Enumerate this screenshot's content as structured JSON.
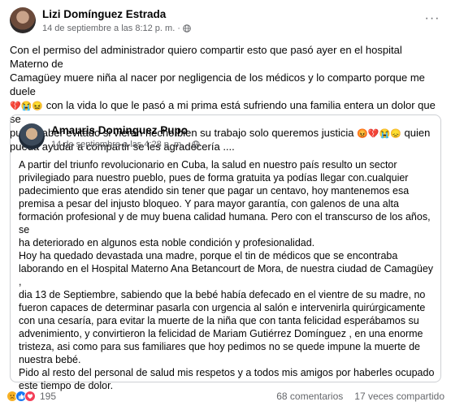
{
  "post": {
    "author": "Lizi Domínguez Estrada",
    "timestamp": "14 de septiembre a las 8:12 p. m.",
    "visibility_separator": "·",
    "more_label": "···",
    "text_line1": "Con el permiso del administrador quiero compartir esto que pasó ayer en el hospital Materno de",
    "text_line2": "Camagüey muere niña al nacer por negligencia de los médicos y lo comparto porque me duele",
    "text_line3_emoji": "💔😭😖",
    "text_line3": " con la vida lo que le pasó a mi prima está sufriendo una familia entera un dolor que se",
    "text_line4": "pudo haber evitado si vieran hecho bien su trabajo solo queremos justicia ",
    "text_line4_emoji": "😡💔😭😞",
    "text_line4_end": " quien",
    "text_line5": "pueda ayudar a compartir se les agradecería ...."
  },
  "shared": {
    "author": "Amauris Dominguez Pupo",
    "timestamp": "14 de septiembre a las 4:28 p. m.",
    "visibility_separator": "·",
    "lines": [
      "A partir del triunfo revolucionario en Cuba, la salud en nuestro país resulto un sector",
      "privilegiado para nuestro pueblo, pues de forma gratuita ya podías llegar con.cualquier",
      "padecimiento que eras atendido sin tener que pagar un centavo, hoy mantenemos esa",
      "premisa a pesar del injusto bloqueo. Y para mayor garantía, con galenos de una alta",
      "formación profesional y de muy buena calidad humana. Pero con el transcurso de los años, se",
      "ha deteriorado en algunos esta noble condición y profesionalidad.",
      "Hoy ha quedado devastada una madre, porque el tin de médicos que se encontraba",
      "laborando en el Hospital Materno Ana Betancourt de Mora, de nuestra ciudad de Camagüey ,",
      "dia 13 de Septiembre, sabiendo que la bebé había defecado en el vientre de su madre, no",
      "fueron capaces de determinar pasarla con urgencia al salón e  intervenirla quirúrgicamente",
      "con una cesaría, para evitar la muerte de la niña que con tanta felicidad esperábamos su",
      "advenimiento, y convirtieron la felicidad de Mariam Gutiérrez Domínguez , en una enorme",
      "tristeza, asi como para sus familiares que hoy pedimos no se quede impune la muerte de",
      "nuestra bebé.",
      "Pido al resto del personal de salud mis respetos y a todos mis amigos por haberles ocupado",
      "este tiempo de dolor."
    ]
  },
  "footer": {
    "reaction_icons": [
      "sad",
      "like",
      "love"
    ],
    "reaction_count": "195",
    "comments": "68 comentarios",
    "shares": "17 veces compartido"
  }
}
